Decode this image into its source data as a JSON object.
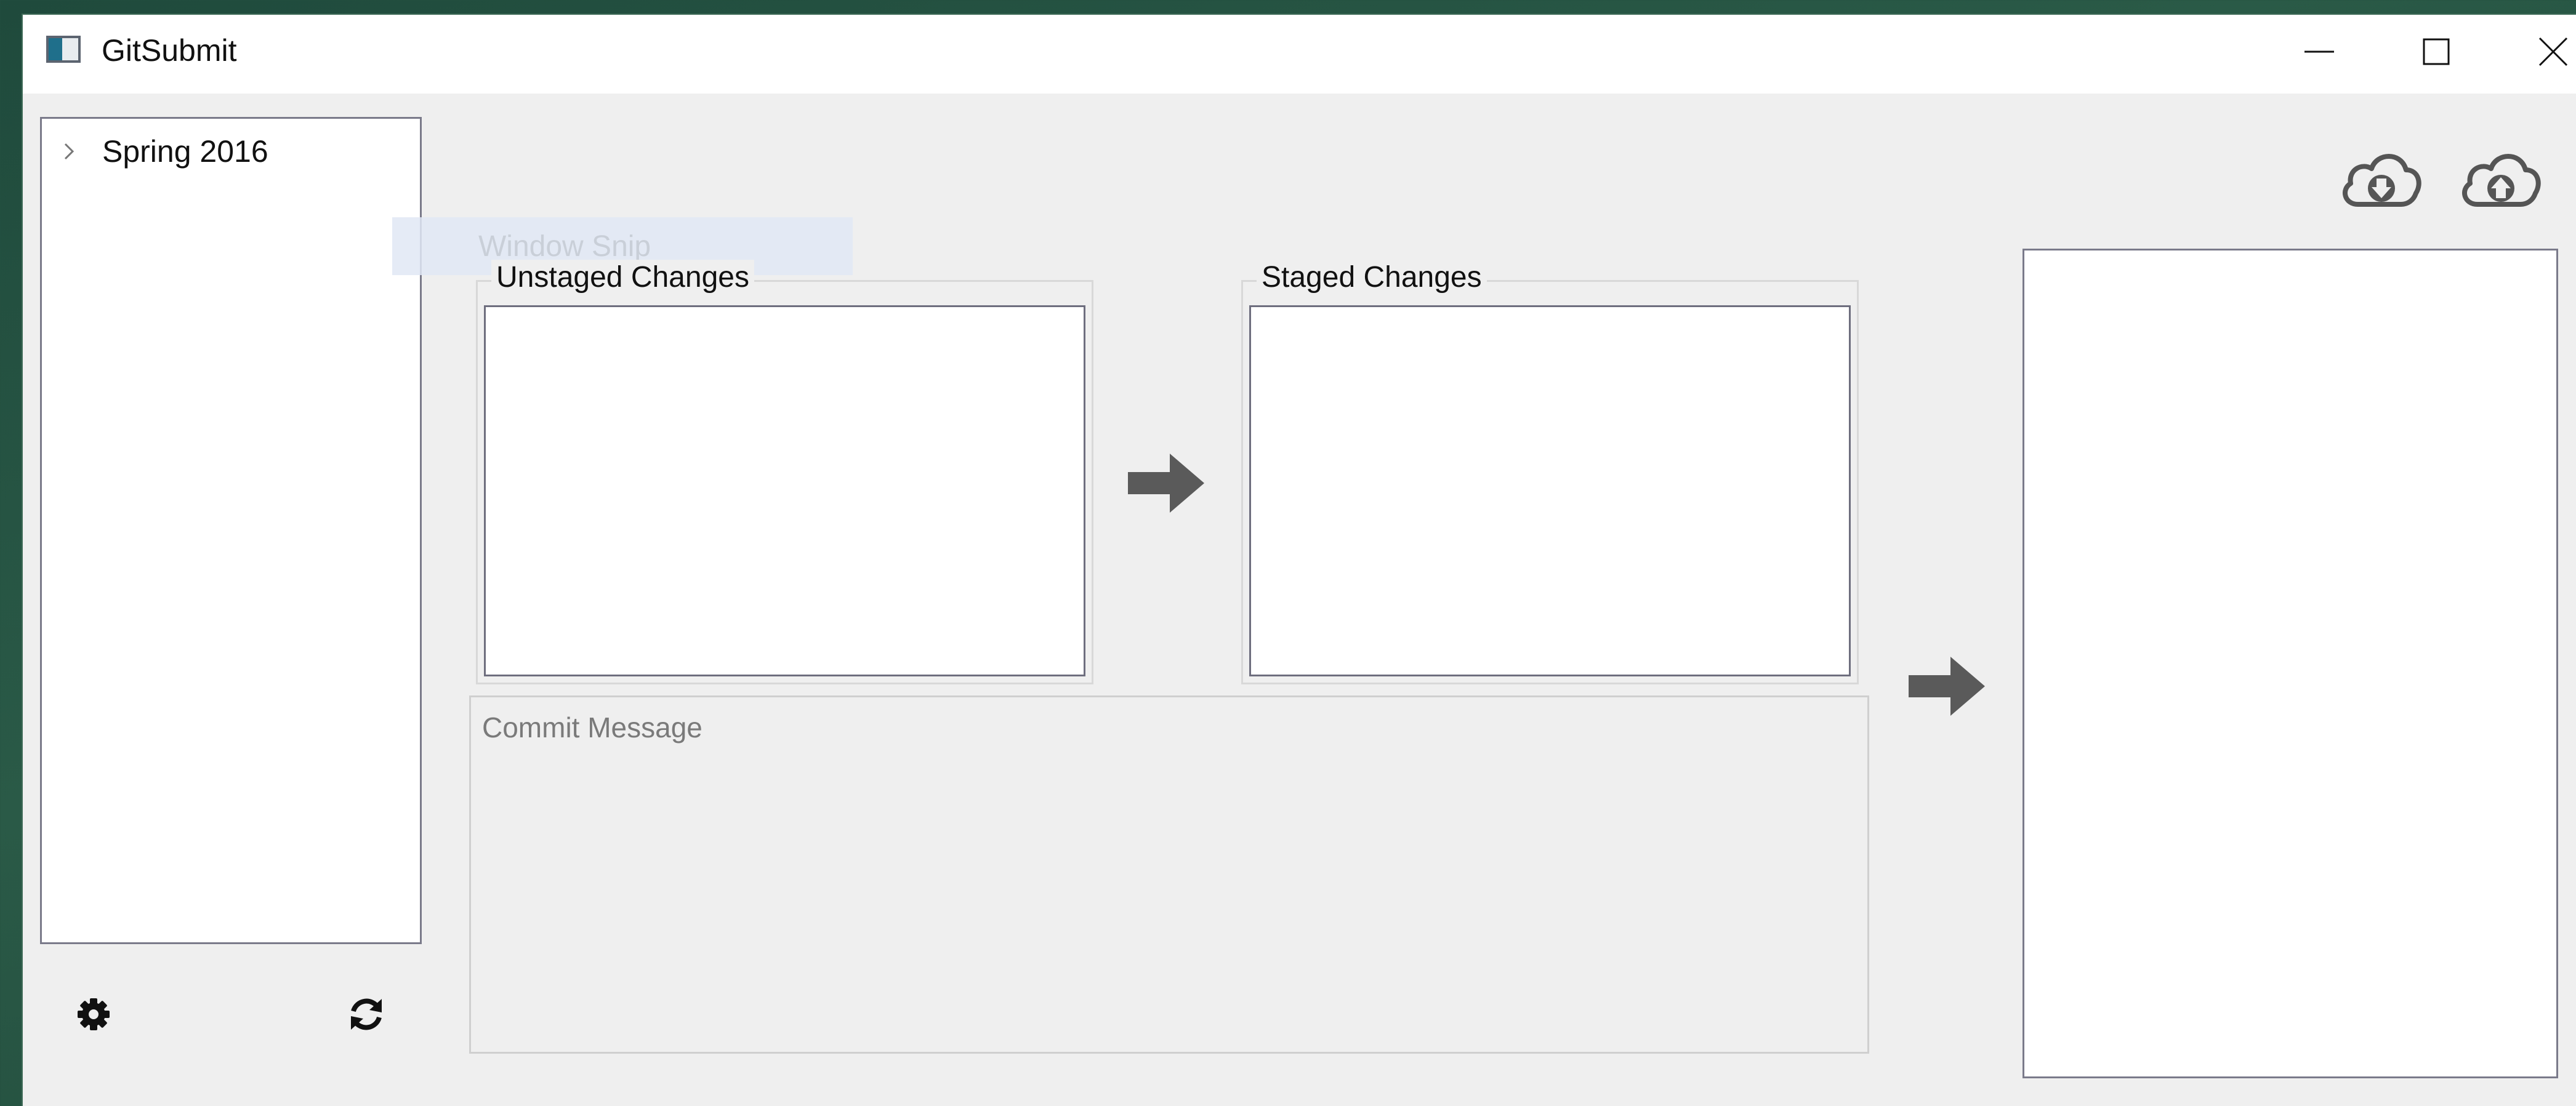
{
  "window": {
    "title": "GitSubmit",
    "controls": {
      "minimize": "minimize",
      "maximize": "maximize",
      "close": "close"
    }
  },
  "tree": {
    "items": [
      {
        "label": "Spring 2016",
        "expanded": false
      }
    ]
  },
  "toolbar": {
    "left_icons": [
      "gear-icon",
      "refresh-icon"
    ],
    "right_icons": [
      "cloud-download-icon",
      "cloud-upload-icon"
    ]
  },
  "unstaged": {
    "label": "Unstaged Changes",
    "items": []
  },
  "staged": {
    "label": "Staged Changes",
    "items": []
  },
  "commit": {
    "placeholder": "Commit Message",
    "value": ""
  },
  "overlay": {
    "text": "Window Snip"
  },
  "colors": {
    "window_bg": "#efefef",
    "titlebar_bg": "#ffffff",
    "panel_border": "#7a7a8a",
    "arrow": "#5a5a5a"
  }
}
